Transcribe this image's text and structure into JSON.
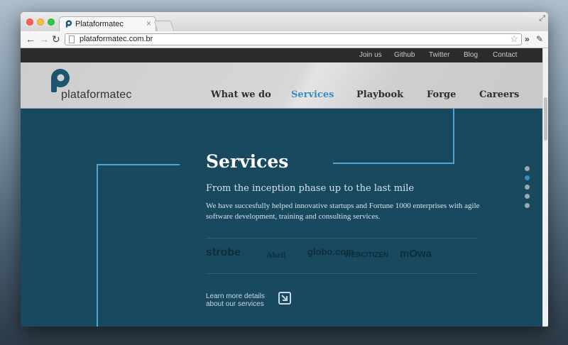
{
  "browser": {
    "tab_title": "Plataformatec",
    "tab_close": "×",
    "url": "plataformatec.com.br",
    "back": "←",
    "forward": "→",
    "reload": "↻",
    "star": "☆",
    "overflow": "»",
    "wrench": "✎",
    "fullscreen": "⤢"
  },
  "topbar": {
    "links": [
      "Join us",
      "Github",
      "Twitter",
      "Blog",
      "Contact"
    ]
  },
  "header": {
    "logo_text": "plataformatec",
    "nav": [
      "What we do",
      "Services",
      "Playbook",
      "Forge",
      "Careers"
    ],
    "active_nav": "Services"
  },
  "services": {
    "title": "Services",
    "subtitle": "From the inception phase up to the last mile",
    "description": "We have succesfully helped innovative startups and Fortune 1000 enterprises with agile software development, training and consulting services.",
    "client_logos": [
      "strobe",
      "Abril",
      "globo.com",
      "WEBCITIZEN",
      "mOwa"
    ],
    "learn_more_line1": "Learn more details",
    "learn_more_line2": "about our services"
  },
  "pager": {
    "total": 5,
    "active_index": 1
  },
  "colors": {
    "page_background": "#18495f",
    "accent_blue": "#3a8bc4",
    "topbar": "#2b2b2b",
    "header_gray": "#d0d0d0"
  }
}
